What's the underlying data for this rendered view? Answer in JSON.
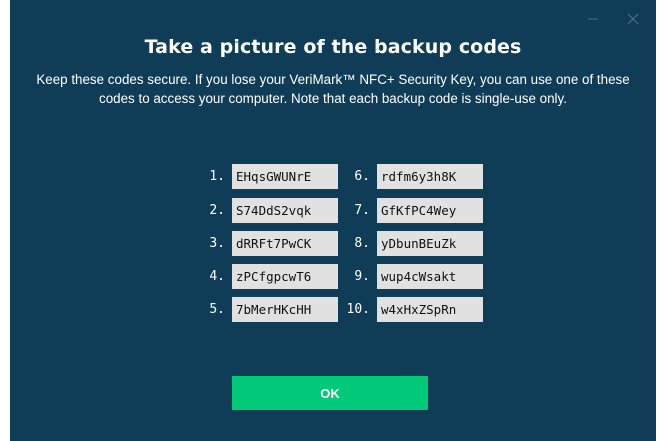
{
  "window": {
    "title": "Take a picture of the backup codes",
    "description": "Keep these codes secure. If you lose your VeriMark™ NFC+ Security Key, you can use one of these codes to access your computer. Note that each backup code is single-use only.",
    "background_color": "#0f3d57",
    "controls": {
      "minimize_icon": "minimize-icon",
      "close_icon": "close-icon"
    }
  },
  "codes": [
    {
      "number": "1.",
      "code": "EHqsGWUNrE"
    },
    {
      "number": "2.",
      "code": "S74DdS2vqk"
    },
    {
      "number": "3.",
      "code": "dRRFt7PwCK"
    },
    {
      "number": "4.",
      "code": "zPCfgpcwT6"
    },
    {
      "number": "5.",
      "code": "7bMerHKcHH"
    },
    {
      "number": "6.",
      "code": "rdfm6y3h8K"
    },
    {
      "number": "7.",
      "code": "GfKfPC4Wey"
    },
    {
      "number": "8.",
      "code": "yDbunBEuZk"
    },
    {
      "number": "9.",
      "code": "wup4cWsakt"
    },
    {
      "number": "10.",
      "code": "w4xHxZSpRn"
    }
  ],
  "ok_button": {
    "label": "OK",
    "color": "#00c97a"
  }
}
